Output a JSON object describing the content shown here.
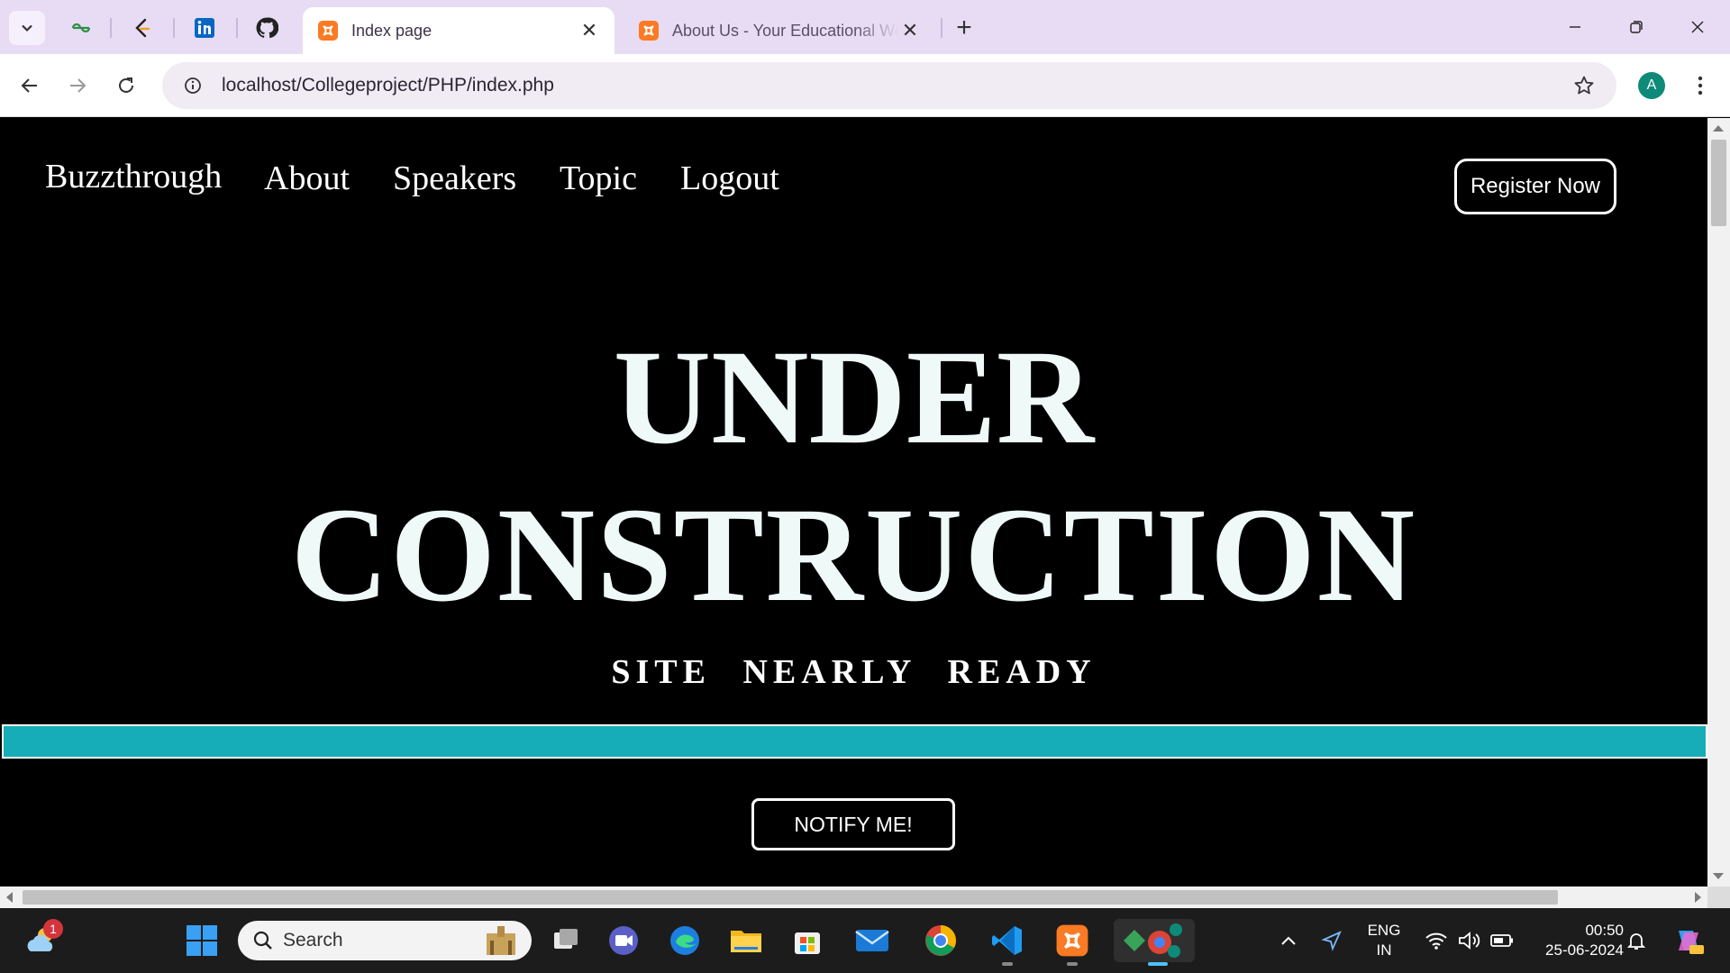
{
  "browser": {
    "tabs": [
      {
        "title": "Index page",
        "active": true
      },
      {
        "title": "About Us - Your Educational Website",
        "active": false
      }
    ],
    "url": "localhost/Collegeproject/PHP/index.php",
    "profile_initial": "A",
    "pinned_tabs": [
      "geeksforgeeks-icon",
      "leetcode-icon",
      "linkedin-icon",
      "github-icon"
    ]
  },
  "site": {
    "brand": "Buzzthrough",
    "nav": [
      "About",
      "Speakers",
      "Topic",
      "Logout"
    ],
    "register_label": "Register Now",
    "hero_line1": "UNDER",
    "hero_line2": "CONSTRUCTION",
    "subtitle": "SITE NEARLY READY",
    "progress_fraction": 1.0,
    "progress_color": "#17adb8",
    "notify_label": "NOTIFY ME!"
  },
  "taskbar": {
    "search_placeholder": "Search",
    "weather_badge": "1",
    "language_line1": "ENG",
    "language_line2": "IN",
    "time": "00:50",
    "date": "25-06-2024"
  }
}
